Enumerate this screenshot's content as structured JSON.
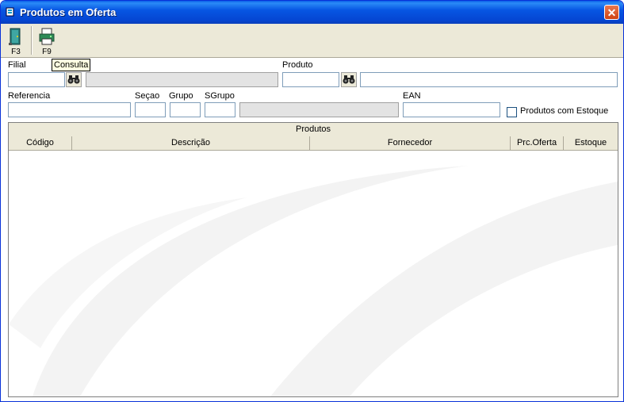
{
  "window": {
    "title": "Produtos em Oferta",
    "close_symbol": "✕"
  },
  "toolbar": {
    "buttons": [
      {
        "label": "F3",
        "icon": "exit-door-icon"
      },
      {
        "label": "F9",
        "icon": "printer-icon"
      }
    ]
  },
  "tooltip": {
    "text": "Consulta"
  },
  "filters": {
    "filial_label": "Filial",
    "produto_label": "Produto",
    "referencia_label": "Referencia",
    "secao_label": "Seçao",
    "grupo_label": "Grupo",
    "sgrupo_label": "SGrupo",
    "ean_label": "EAN",
    "estoque_checkbox_label": "Produtos com Estoque",
    "estoque_checked": false,
    "filial_value": "",
    "filial_desc_value": "",
    "produto_value": "",
    "produto_desc_value": "",
    "referencia_value": "",
    "secao_value": "",
    "grupo_value": "",
    "sgrupo_value": "",
    "grupo_desc_value": "",
    "ean_value": ""
  },
  "grid": {
    "caption": "Produtos",
    "columns": [
      "Código",
      "Descrição",
      "Fornecedor",
      "Prc.Oferta",
      "Estoque"
    ],
    "rows": []
  }
}
